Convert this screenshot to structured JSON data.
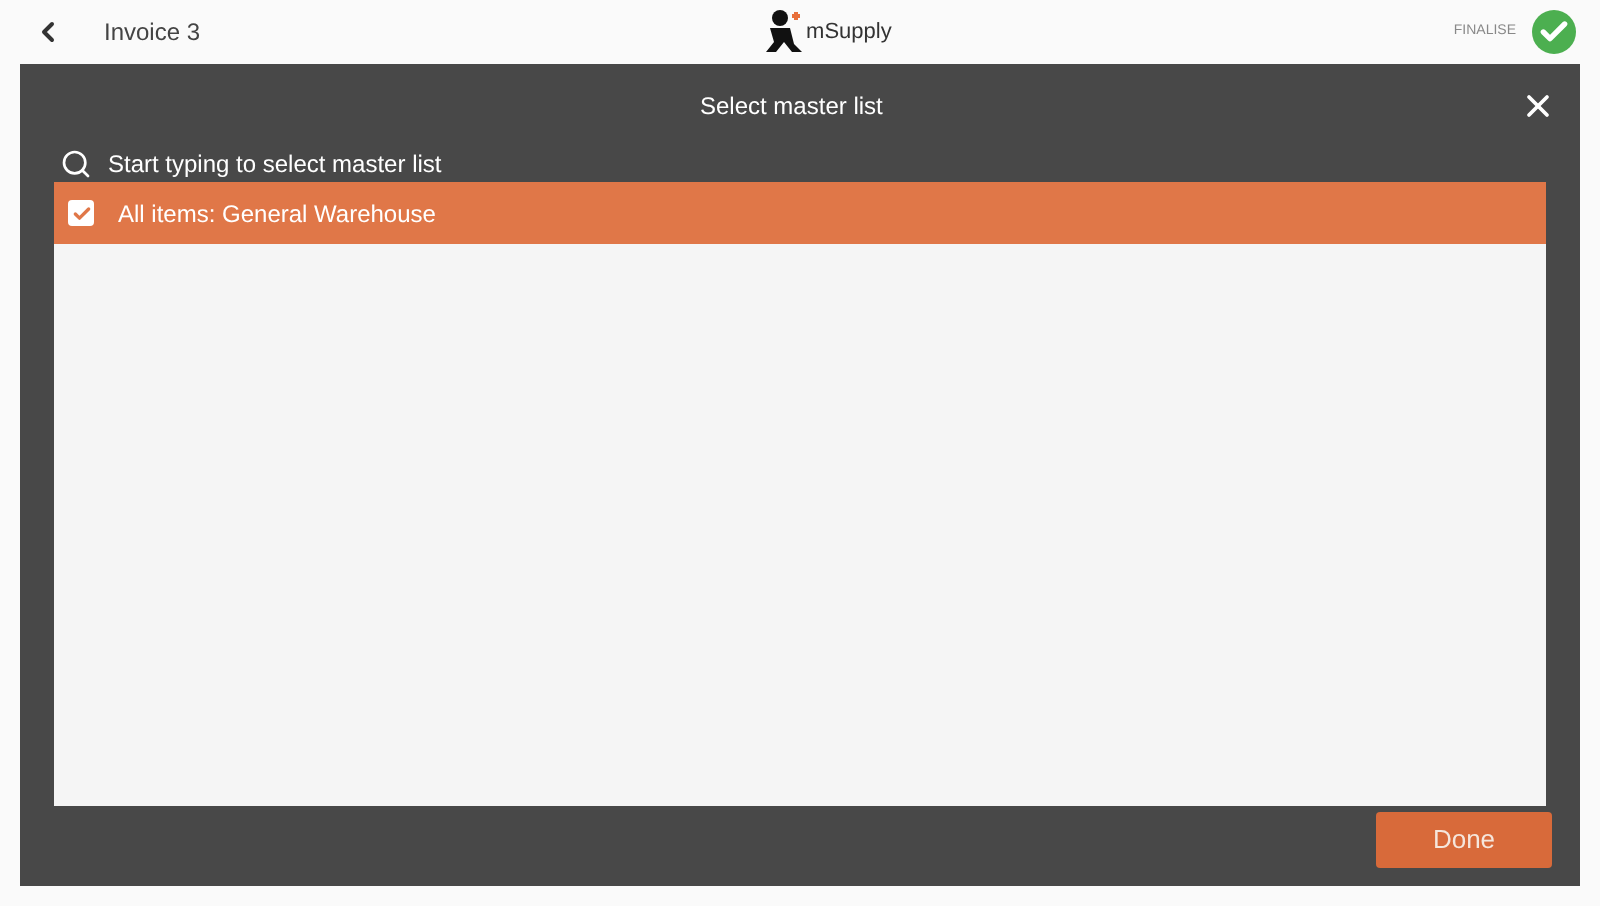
{
  "header": {
    "title": "Invoice 3",
    "logo_text": "mSupply",
    "finalise_label": "FINALISE"
  },
  "modal": {
    "title": "Select master list",
    "search": {
      "placeholder": "Start typing to select master list"
    },
    "items": [
      {
        "label": "All items: General Warehouse",
        "selected": true
      }
    ],
    "done_label": "Done"
  }
}
